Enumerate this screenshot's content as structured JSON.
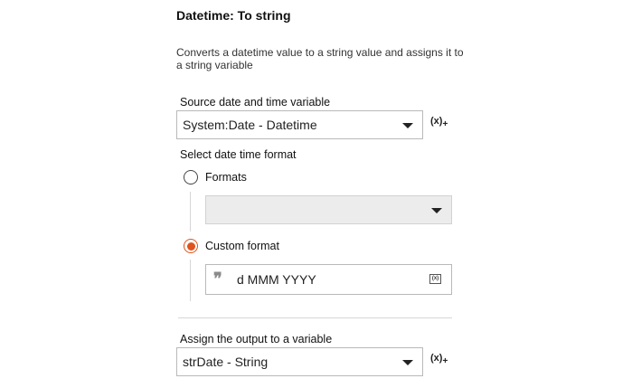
{
  "title": "Datetime: To string",
  "description": "Converts a datetime value to a string value and assigns it to a string variable",
  "source": {
    "label": "Source date and time variable",
    "value": "System:Date - Datetime",
    "var_button": "(x)"
  },
  "format_section": {
    "label": "Select date time format",
    "formats_option": "Formats",
    "formats_value": "",
    "custom_option": "Custom format",
    "custom_value": "d MMM YYYY",
    "custom_quote": "❞",
    "insert_var": "(x)",
    "selected": "custom"
  },
  "output": {
    "label": "Assign the output to a variable",
    "value": "strDate - String",
    "var_button": "(x)"
  },
  "colors": {
    "accent": "#e0531c",
    "border": "#b9b9b9",
    "disabled_bg": "#ececec"
  }
}
